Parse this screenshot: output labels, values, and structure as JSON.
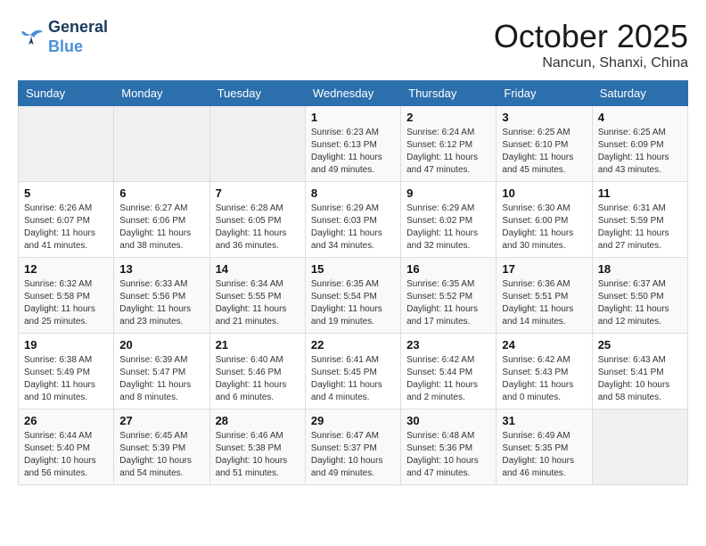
{
  "header": {
    "logo_line1": "General",
    "logo_line2": "Blue",
    "month": "October 2025",
    "location": "Nancun, Shanxi, China"
  },
  "weekdays": [
    "Sunday",
    "Monday",
    "Tuesday",
    "Wednesday",
    "Thursday",
    "Friday",
    "Saturday"
  ],
  "weeks": [
    [
      {
        "day": "",
        "info": ""
      },
      {
        "day": "",
        "info": ""
      },
      {
        "day": "",
        "info": ""
      },
      {
        "day": "1",
        "info": "Sunrise: 6:23 AM\nSunset: 6:13 PM\nDaylight: 11 hours\nand 49 minutes."
      },
      {
        "day": "2",
        "info": "Sunrise: 6:24 AM\nSunset: 6:12 PM\nDaylight: 11 hours\nand 47 minutes."
      },
      {
        "day": "3",
        "info": "Sunrise: 6:25 AM\nSunset: 6:10 PM\nDaylight: 11 hours\nand 45 minutes."
      },
      {
        "day": "4",
        "info": "Sunrise: 6:25 AM\nSunset: 6:09 PM\nDaylight: 11 hours\nand 43 minutes."
      }
    ],
    [
      {
        "day": "5",
        "info": "Sunrise: 6:26 AM\nSunset: 6:07 PM\nDaylight: 11 hours\nand 41 minutes."
      },
      {
        "day": "6",
        "info": "Sunrise: 6:27 AM\nSunset: 6:06 PM\nDaylight: 11 hours\nand 38 minutes."
      },
      {
        "day": "7",
        "info": "Sunrise: 6:28 AM\nSunset: 6:05 PM\nDaylight: 11 hours\nand 36 minutes."
      },
      {
        "day": "8",
        "info": "Sunrise: 6:29 AM\nSunset: 6:03 PM\nDaylight: 11 hours\nand 34 minutes."
      },
      {
        "day": "9",
        "info": "Sunrise: 6:29 AM\nSunset: 6:02 PM\nDaylight: 11 hours\nand 32 minutes."
      },
      {
        "day": "10",
        "info": "Sunrise: 6:30 AM\nSunset: 6:00 PM\nDaylight: 11 hours\nand 30 minutes."
      },
      {
        "day": "11",
        "info": "Sunrise: 6:31 AM\nSunset: 5:59 PM\nDaylight: 11 hours\nand 27 minutes."
      }
    ],
    [
      {
        "day": "12",
        "info": "Sunrise: 6:32 AM\nSunset: 5:58 PM\nDaylight: 11 hours\nand 25 minutes."
      },
      {
        "day": "13",
        "info": "Sunrise: 6:33 AM\nSunset: 5:56 PM\nDaylight: 11 hours\nand 23 minutes."
      },
      {
        "day": "14",
        "info": "Sunrise: 6:34 AM\nSunset: 5:55 PM\nDaylight: 11 hours\nand 21 minutes."
      },
      {
        "day": "15",
        "info": "Sunrise: 6:35 AM\nSunset: 5:54 PM\nDaylight: 11 hours\nand 19 minutes."
      },
      {
        "day": "16",
        "info": "Sunrise: 6:35 AM\nSunset: 5:52 PM\nDaylight: 11 hours\nand 17 minutes."
      },
      {
        "day": "17",
        "info": "Sunrise: 6:36 AM\nSunset: 5:51 PM\nDaylight: 11 hours\nand 14 minutes."
      },
      {
        "day": "18",
        "info": "Sunrise: 6:37 AM\nSunset: 5:50 PM\nDaylight: 11 hours\nand 12 minutes."
      }
    ],
    [
      {
        "day": "19",
        "info": "Sunrise: 6:38 AM\nSunset: 5:49 PM\nDaylight: 11 hours\nand 10 minutes."
      },
      {
        "day": "20",
        "info": "Sunrise: 6:39 AM\nSunset: 5:47 PM\nDaylight: 11 hours\nand 8 minutes."
      },
      {
        "day": "21",
        "info": "Sunrise: 6:40 AM\nSunset: 5:46 PM\nDaylight: 11 hours\nand 6 minutes."
      },
      {
        "day": "22",
        "info": "Sunrise: 6:41 AM\nSunset: 5:45 PM\nDaylight: 11 hours\nand 4 minutes."
      },
      {
        "day": "23",
        "info": "Sunrise: 6:42 AM\nSunset: 5:44 PM\nDaylight: 11 hours\nand 2 minutes."
      },
      {
        "day": "24",
        "info": "Sunrise: 6:42 AM\nSunset: 5:43 PM\nDaylight: 11 hours\nand 0 minutes."
      },
      {
        "day": "25",
        "info": "Sunrise: 6:43 AM\nSunset: 5:41 PM\nDaylight: 10 hours\nand 58 minutes."
      }
    ],
    [
      {
        "day": "26",
        "info": "Sunrise: 6:44 AM\nSunset: 5:40 PM\nDaylight: 10 hours\nand 56 minutes."
      },
      {
        "day": "27",
        "info": "Sunrise: 6:45 AM\nSunset: 5:39 PM\nDaylight: 10 hours\nand 54 minutes."
      },
      {
        "day": "28",
        "info": "Sunrise: 6:46 AM\nSunset: 5:38 PM\nDaylight: 10 hours\nand 51 minutes."
      },
      {
        "day": "29",
        "info": "Sunrise: 6:47 AM\nSunset: 5:37 PM\nDaylight: 10 hours\nand 49 minutes."
      },
      {
        "day": "30",
        "info": "Sunrise: 6:48 AM\nSunset: 5:36 PM\nDaylight: 10 hours\nand 47 minutes."
      },
      {
        "day": "31",
        "info": "Sunrise: 6:49 AM\nSunset: 5:35 PM\nDaylight: 10 hours\nand 46 minutes."
      },
      {
        "day": "",
        "info": ""
      }
    ]
  ]
}
